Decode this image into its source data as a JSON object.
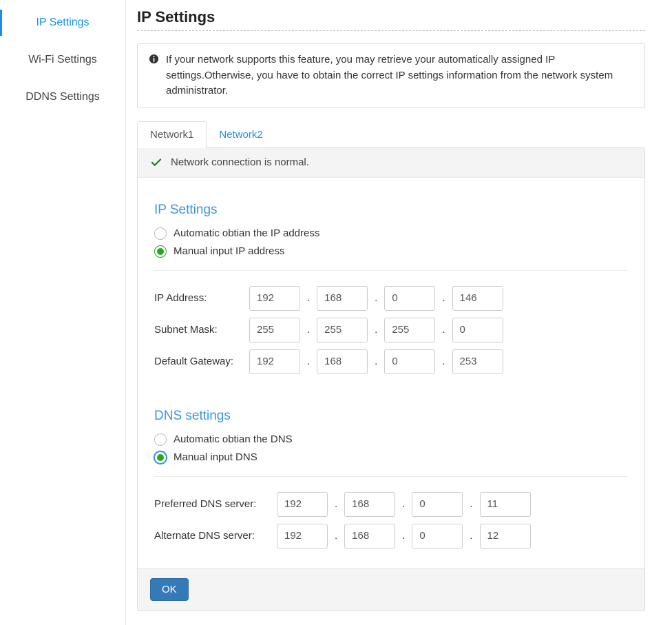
{
  "sidebar": {
    "items": [
      {
        "label": "IP Settings",
        "active": true
      },
      {
        "label": "Wi-Fi Settings",
        "active": false
      },
      {
        "label": "DDNS Settings",
        "active": false
      }
    ]
  },
  "page": {
    "title": "IP Settings"
  },
  "info": {
    "text": "If your network supports this feature, you may retrieve your automatically assigned IP settings.Otherwise, you have to obtain the correct IP settings information from the network system administrator."
  },
  "tabs": [
    {
      "label": "Network1",
      "active": true
    },
    {
      "label": "Network2",
      "active": false
    }
  ],
  "status": {
    "text": "Network connection is normal."
  },
  "ip_section": {
    "title": "IP Settings",
    "radios": {
      "auto": "Automatic obtian the IP address",
      "manual": "Manual input IP address",
      "selected": "manual"
    },
    "rows": {
      "ip": {
        "label": "IP Address:",
        "octets": [
          "192",
          "168",
          "0",
          "146"
        ]
      },
      "mask": {
        "label": "Subnet Mask:",
        "octets": [
          "255",
          "255",
          "255",
          "0"
        ]
      },
      "gateway": {
        "label": "Default Gateway:",
        "octets": [
          "192",
          "168",
          "0",
          "253"
        ]
      }
    }
  },
  "dns_section": {
    "title": "DNS settings",
    "radios": {
      "auto": "Automatic obtian the DNS",
      "manual": "Manual input DNS",
      "selected": "manual"
    },
    "rows": {
      "preferred": {
        "label": "Preferred DNS server:",
        "octets": [
          "192",
          "168",
          "0",
          "11"
        ]
      },
      "alternate": {
        "label": "Alternate DNS server:",
        "octets": [
          "192",
          "168",
          "0",
          "12"
        ]
      }
    }
  },
  "footer": {
    "ok": "OK"
  }
}
